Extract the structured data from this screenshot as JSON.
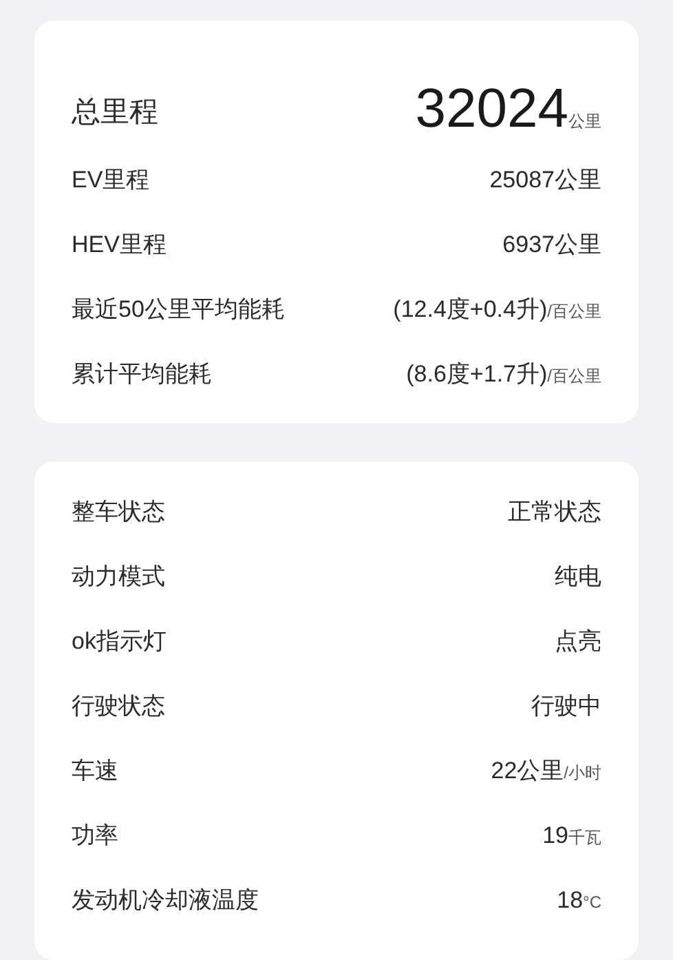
{
  "mileage_card": {
    "total": {
      "label": "总里程",
      "value": "32024",
      "unit": "公里"
    },
    "rows": [
      {
        "label": "EV里程",
        "value": "25087公里"
      },
      {
        "label": "HEV里程",
        "value": "6937公里"
      },
      {
        "label": "最近50公里平均能耗",
        "value": "(12.4度+0.4升)",
        "unit": "/百公里"
      },
      {
        "label": "累计平均能耗",
        "value": "(8.6度+1.7升)",
        "unit": "/百公里"
      }
    ]
  },
  "status_card": {
    "rows": [
      {
        "label": "整车状态",
        "value": "正常状态"
      },
      {
        "label": "动力模式",
        "value": "纯电"
      },
      {
        "label": "ok指示灯",
        "value": "点亮"
      },
      {
        "label": "行驶状态",
        "value": "行驶中"
      },
      {
        "label": "车速",
        "value": "22公里",
        "unit": "/小时"
      },
      {
        "label": "功率",
        "value": "19",
        "unit": "千瓦"
      },
      {
        "label": "发动机冷却液温度",
        "value": "18",
        "unit": "°C"
      }
    ]
  }
}
